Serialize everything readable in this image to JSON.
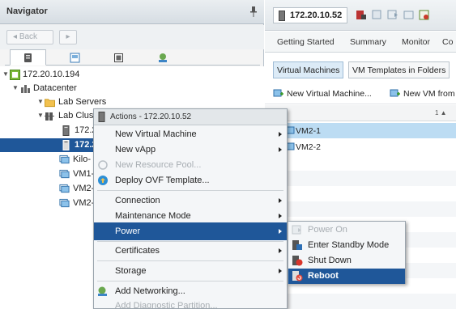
{
  "navigator": {
    "title": "Navigator",
    "back_label": "Back",
    "tabs": [
      "hosts-and-clusters",
      "vms-and-templates",
      "storage",
      "networking"
    ],
    "tree": [
      {
        "label": "172.20.10.194",
        "icon": "vcenter-icon",
        "expanded": true
      },
      {
        "label": "Datacenter",
        "icon": "datacenter-icon",
        "expanded": true
      },
      {
        "label": "Lab Servers",
        "icon": "folder-icon",
        "expanded": true
      },
      {
        "label": "Lab Clus",
        "icon": "cluster-icon",
        "expanded": true
      },
      {
        "label": "172.2",
        "icon": "host-icon"
      },
      {
        "label": "172.2",
        "icon": "host-icon",
        "selected": true
      },
      {
        "label": "Kilo-",
        "icon": "vm-icon"
      },
      {
        "label": "VM1-",
        "icon": "vm-icon"
      },
      {
        "label": "VM2-",
        "icon": "vm-icon"
      },
      {
        "label": "VM2-",
        "icon": "vm-icon"
      }
    ]
  },
  "object_header": {
    "title": "172.20.10.52"
  },
  "top_tabs": [
    "Getting Started",
    "Summary",
    "Monitor",
    "Co"
  ],
  "sub_tabs": [
    "Virtual Machines",
    "VM Templates in Folders"
  ],
  "vm_toolbar": {
    "new_vm": "New Virtual Machine...",
    "new_vm_from": "New VM from"
  },
  "grid": {
    "column_name": "me",
    "sort_indicator": "1 ▲",
    "rows": [
      "VM2-1",
      "VM2-2"
    ]
  },
  "actions_menu": {
    "header": "Actions - 172.20.10.52",
    "items": [
      {
        "label": "New Virtual Machine",
        "submenu": true
      },
      {
        "label": "New vApp",
        "submenu": true
      },
      {
        "label": "New Resource Pool...",
        "disabled": true
      },
      {
        "label": "Deploy OVF Template..."
      },
      {
        "label": "Connection",
        "submenu": true
      },
      {
        "label": "Maintenance Mode",
        "submenu": true
      },
      {
        "label": "Power",
        "submenu": true,
        "highlighted": true
      },
      {
        "label": "Certificates",
        "submenu": true
      },
      {
        "label": "Storage",
        "submenu": true
      },
      {
        "label": "Add Networking..."
      },
      {
        "label": "Add Diagnostic Partition...",
        "disabled": true
      }
    ]
  },
  "power_menu": {
    "items": [
      {
        "label": "Power On",
        "disabled": true
      },
      {
        "label": "Enter Standby Mode"
      },
      {
        "label": "Shut Down"
      },
      {
        "label": "Reboot",
        "highlighted": true
      }
    ]
  },
  "colors": {
    "selection_blue": "#1f5799",
    "grid_selection": "#bcdcf3"
  }
}
